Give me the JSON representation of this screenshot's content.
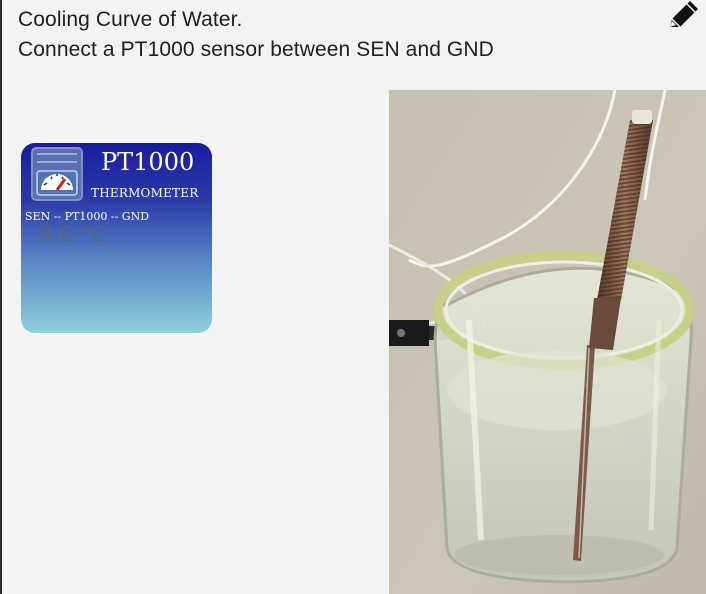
{
  "header": {
    "title_line": "Cooling Curve of Water.",
    "instruction_line": "Connect a PT1000 sensor between SEN and GND"
  },
  "toolbar": {
    "edit_icon": "pencil-icon"
  },
  "widget": {
    "title": "PT1000",
    "subtitle": "THERMOMETER",
    "wiring": "SEN -- PT1000 -- GND",
    "reading": "0.0 °C",
    "icon": "gauge-icon",
    "colors": {
      "top": "#1a1c9e",
      "bottom": "#8fd0dc"
    }
  },
  "photo": {
    "subject": "pt1000-probe-in-glass-of-water"
  }
}
